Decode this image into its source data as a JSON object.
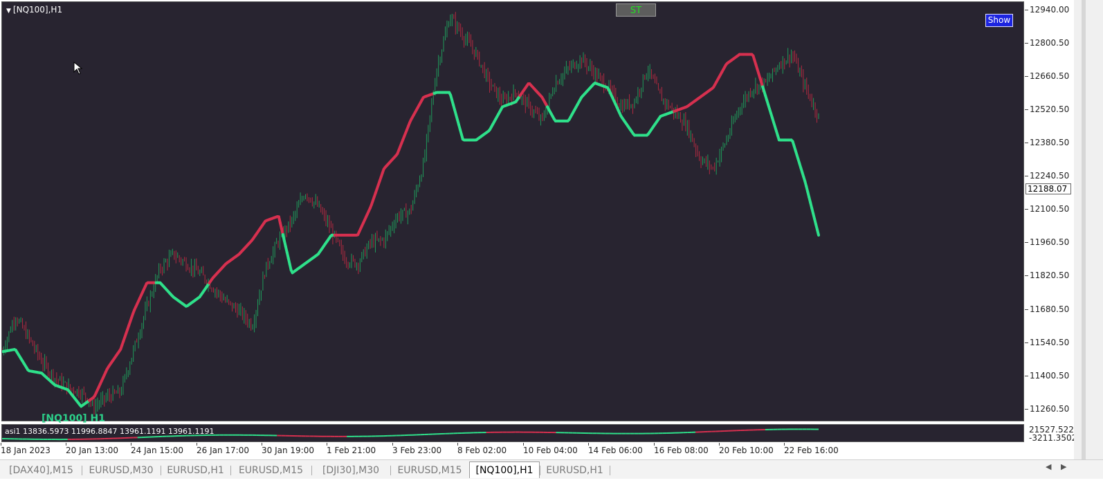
{
  "window": {
    "title": "[NQ100],H1"
  },
  "buttons": {
    "st": "ST",
    "show": "Show"
  },
  "watermark": "[NQ100] H1",
  "current_price": "12188.07",
  "indicator": {
    "label": "asi1  13836.5973 11996.8847 13961.1191 13961.1191",
    "axis_top": "21527.5221",
    "axis_bottom": "-3211.3502"
  },
  "price_axis": {
    "labels": [
      "12940.00",
      "12800.50",
      "12660.50",
      "12520.50",
      "12380.50",
      "12240.50",
      "12100.50",
      "11960.50",
      "11820.50",
      "11680.50",
      "11540.50",
      "11400.50",
      "11260.50"
    ]
  },
  "time_axis": {
    "labels": [
      "18 Jan 2023",
      "20 Jan 13:00",
      "24 Jan 15:00",
      "26 Jan 17:00",
      "30 Jan 19:00",
      "1 Feb 21:00",
      "3 Feb 23:00",
      "8 Feb 02:00",
      "10 Feb 04:00",
      "14 Feb 06:00",
      "16 Feb 08:00",
      "20 Feb 10:00",
      "22 Feb 16:00"
    ]
  },
  "tabs": [
    {
      "label": "[DAX40],M15",
      "active": false
    },
    {
      "label": "EURUSD,M30",
      "active": false
    },
    {
      "label": "EURUSD,H1",
      "active": false
    },
    {
      "label": "EURUSD,M15",
      "active": false
    },
    {
      "label": "[DJI30],M30",
      "active": false
    },
    {
      "label": "EURUSD,M15",
      "active": false
    },
    {
      "label": "[NQ100],H1",
      "active": true
    },
    {
      "label": "EURUSD,H1",
      "active": false
    }
  ],
  "colors": {
    "background": "#282430",
    "bull": "#2fe08a",
    "bear": "#d6304f",
    "candle_up": "#1f9a5a",
    "candle_down": "#b02a40"
  },
  "chart_data": {
    "type": "line",
    "title": "[NQ100],H1",
    "ylim": [
      11200,
      12960
    ],
    "x_labels": [
      "18 Jan 2023",
      "20 Jan 13:00",
      "24 Jan 15:00",
      "26 Jan 17:00",
      "30 Jan 19:00",
      "1 Feb 21:00",
      "3 Feb 23:00",
      "8 Feb 02:00",
      "10 Feb 04:00",
      "14 Feb 06:00",
      "16 Feb 08:00",
      "20 Feb 10:00",
      "22 Feb 16:00"
    ],
    "x": [
      0,
      10,
      20,
      30,
      40,
      50,
      60,
      70,
      80,
      90,
      100,
      110,
      120,
      130,
      140,
      150,
      160,
      170,
      180,
      190,
      200,
      210,
      220,
      230,
      240,
      250,
      260,
      270,
      280,
      290,
      300,
      310,
      320,
      330,
      340,
      350,
      360,
      370,
      380,
      390,
      400,
      410,
      420,
      430,
      440,
      450,
      460,
      470,
      480,
      490,
      500,
      510,
      520,
      530,
      540,
      550,
      560,
      570,
      580,
      590,
      600,
      610,
      620
    ],
    "series": [
      {
        "kind": "price",
        "values": [
          11490,
          11640,
          11550,
          11450,
          11380,
          11340,
          11320,
          11260,
          11300,
          11320,
          11500,
          11680,
          11840,
          11900,
          11860,
          11820,
          11760,
          11700,
          11660,
          11600,
          11840,
          11960,
          12040,
          12160,
          12100,
          12000,
          11880,
          11860,
          11950,
          11960,
          12060,
          12080,
          12280,
          12680,
          12900,
          12820,
          12740,
          12620,
          12540,
          12580,
          12520,
          12460,
          12620,
          12680,
          12720,
          12660,
          12600,
          12520,
          12540,
          12680,
          12560,
          12500,
          12440,
          12300,
          12260,
          12380,
          12520,
          12600,
          12620,
          12700,
          12740,
          12600,
          12480
        ]
      },
      {
        "kind": "supertrend",
        "values": [
          11490,
          11500,
          11410,
          11400,
          11350,
          11330,
          11260,
          11300,
          11420,
          11500,
          11660,
          11780,
          11780,
          11720,
          11680,
          11720,
          11800,
          11860,
          11900,
          11960,
          12040,
          12060,
          11820,
          11860,
          11900,
          11980,
          11980,
          11980,
          12100,
          12260,
          12320,
          12460,
          12560,
          12580,
          12580,
          12380,
          12380,
          12420,
          12520,
          12540,
          12620,
          12560,
          12460,
          12460,
          12560,
          12620,
          12600,
          12480,
          12400,
          12400,
          12480,
          12500,
          12520,
          12560,
          12600,
          12700,
          12740,
          12740,
          12560,
          12380,
          12380,
          12200,
          11980
        ]
      }
    ]
  }
}
